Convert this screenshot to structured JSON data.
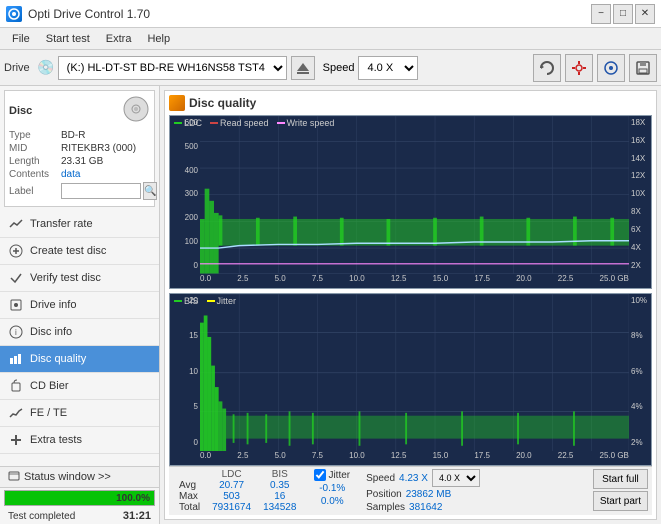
{
  "titleBar": {
    "title": "Opti Drive Control 1.70",
    "icon": "disc-icon",
    "minimizeLabel": "−",
    "maximizeLabel": "□",
    "closeLabel": "✕"
  },
  "menuBar": {
    "items": [
      "File",
      "Start test",
      "Extra",
      "Help"
    ]
  },
  "toolbar": {
    "driveLabel": "Drive",
    "driveValue": "(K:) HL-DT-ST BD-RE WH16NS58 TST4",
    "speedLabel": "Speed",
    "speedValue": "4.0 X"
  },
  "disc": {
    "panelTitle": "Disc",
    "typeLabel": "Type",
    "typeValue": "BD-R",
    "midLabel": "MID",
    "midValue": "RITEKBR3 (000)",
    "lengthLabel": "Length",
    "lengthValue": "23.31 GB",
    "contentsLabel": "Contents",
    "contentsValue": "data",
    "labelLabel": "Label"
  },
  "nav": {
    "items": [
      {
        "id": "transfer-rate",
        "label": "Transfer rate",
        "icon": "📈"
      },
      {
        "id": "create-test-disc",
        "label": "Create test disc",
        "icon": "💿"
      },
      {
        "id": "verify-test-disc",
        "label": "Verify test disc",
        "icon": "✔"
      },
      {
        "id": "drive-info",
        "label": "Drive info",
        "icon": "💾"
      },
      {
        "id": "disc-info",
        "label": "Disc info",
        "icon": "ℹ"
      },
      {
        "id": "disc-quality",
        "label": "Disc quality",
        "icon": "📊",
        "active": true
      },
      {
        "id": "cd-bier",
        "label": "CD Bier",
        "icon": "🍺"
      },
      {
        "id": "fe-te",
        "label": "FE / TE",
        "icon": "📉"
      },
      {
        "id": "extra-tests",
        "label": "Extra tests",
        "icon": "🔧"
      }
    ]
  },
  "statusWindow": {
    "label": "Status window >>",
    "progressPercent": 100,
    "progressLabel": "100.0%",
    "statusText": "Test completed",
    "time": "31:21"
  },
  "discQuality": {
    "title": "Disc quality",
    "chart1": {
      "legend": [
        {
          "color": "#22cc22",
          "label": "LDC"
        },
        {
          "color": "#cc4444",
          "label": "Read speed"
        },
        {
          "color": "#ff88ff",
          "label": "Write speed"
        }
      ],
      "yAxisLeft": [
        "600",
        "500",
        "400",
        "300",
        "200",
        "100",
        "0"
      ],
      "yAxisRight": [
        "18X",
        "16X",
        "14X",
        "12X",
        "10X",
        "8X",
        "6X",
        "4X",
        "2X"
      ],
      "xAxis": [
        "0.0",
        "2.5",
        "5.0",
        "7.5",
        "10.0",
        "12.5",
        "15.0",
        "17.5",
        "20.0",
        "22.5",
        "25.0 GB"
      ]
    },
    "chart2": {
      "legend": [
        {
          "color": "#22cc22",
          "label": "BIS"
        },
        {
          "color": "#ffff00",
          "label": "Jitter"
        }
      ],
      "yAxisLeft": [
        "20",
        "15",
        "10",
        "5",
        "0"
      ],
      "yAxisRight": [
        "10%",
        "8%",
        "6%",
        "4%",
        "2%"
      ],
      "xAxis": [
        "0.0",
        "2.5",
        "5.0",
        "7.5",
        "10.0",
        "12.5",
        "15.0",
        "17.5",
        "20.0",
        "22.5",
        "25.0 GB"
      ]
    }
  },
  "stats": {
    "headers": [
      "LDC",
      "BIS",
      "",
      "Jitter",
      "Speed",
      ""
    ],
    "rows": [
      {
        "label": "Avg",
        "ldc": "20.77",
        "bis": "0.35",
        "jitter": "-0.1%",
        "speed": "4.23 X",
        "speedTarget": "4.0 X"
      },
      {
        "label": "Max",
        "ldc": "503",
        "bis": "16",
        "jitter": "0.0%",
        "position": "23862 MB"
      },
      {
        "label": "Total",
        "ldc": "7931674",
        "bis": "134528",
        "samples": "381642"
      }
    ],
    "jitterChecked": true,
    "startFullLabel": "Start full",
    "startPartLabel": "Start part",
    "positionLabel": "Position",
    "samplesLabel": "Samples"
  }
}
